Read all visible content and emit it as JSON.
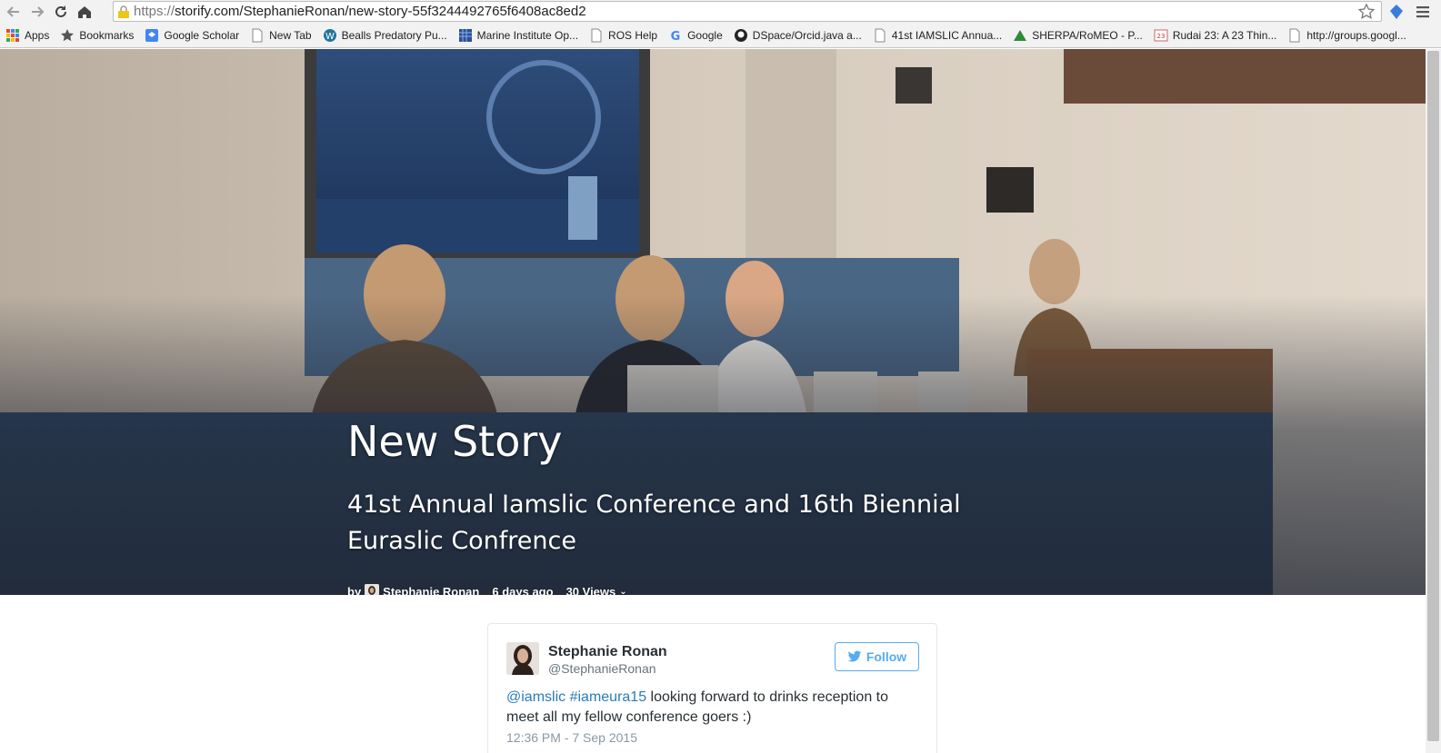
{
  "browser": {
    "url_scheme": "https://",
    "url_rest": "storify.com/StephanieRonan/new-story-55f3244492765f6408ac8ed2",
    "bookmarks": [
      {
        "label": "Apps",
        "icon": "apps-grid-icon"
      },
      {
        "label": "Bookmarks",
        "icon": "star-icon"
      },
      {
        "label": "Google Scholar",
        "icon": "scholar-icon"
      },
      {
        "label": "New Tab",
        "icon": "page-icon"
      },
      {
        "label": "Bealls Predatory Pu...",
        "icon": "wordpress-icon"
      },
      {
        "label": "Marine Institute Op...",
        "icon": "grid-icon"
      },
      {
        "label": "ROS Help",
        "icon": "page-icon"
      },
      {
        "label": "Google",
        "icon": "google-icon"
      },
      {
        "label": "DSpace/Orcid.java a...",
        "icon": "github-icon"
      },
      {
        "label": "41st IAMSLIC Annua...",
        "icon": "page-icon"
      },
      {
        "label": "SHERPA/RoMEO - P...",
        "icon": "sherpa-icon"
      },
      {
        "label": "Rudai 23: A 23 Thin...",
        "icon": "rudai-icon"
      },
      {
        "label": "http://groups.googl...",
        "icon": "page-icon"
      }
    ]
  },
  "story": {
    "title": "New Story",
    "subtitle": "41st Annual Iamslic Conference and 16th Biennial Euraslic Confrence",
    "by": "by",
    "author": "Stephanie Ronan",
    "time_ago": "6 days ago",
    "views": "30 Views"
  },
  "tweet": {
    "name": "Stephanie Ronan",
    "handle": "@StephanieRonan",
    "follow_label": "Follow",
    "mention": "@iamslic",
    "hashtag": "#iameura15",
    "text": " looking forward to drinks reception to meet all my fellow conference goers :)",
    "timestamp": "12:36 PM - 7 Sep 2015"
  },
  "colors": {
    "twitter_blue": "#55acee",
    "link_blue": "#2b7bb9"
  }
}
